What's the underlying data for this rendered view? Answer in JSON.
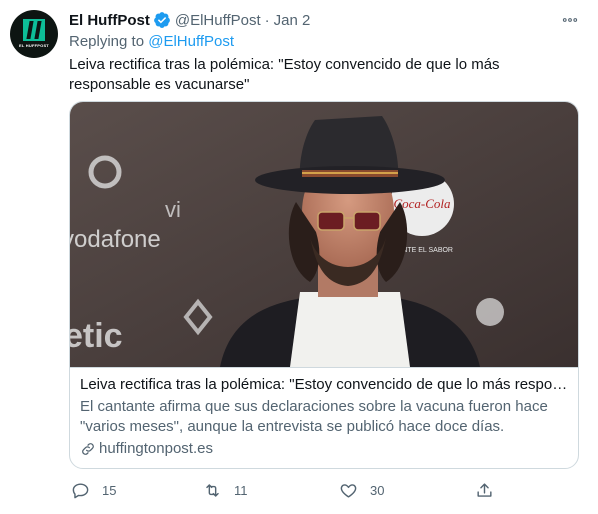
{
  "author": {
    "name": "El HuffPost",
    "handle": "@ElHuffPost",
    "separator": "·",
    "date": "Jan 2",
    "avatar_text": "EL HUFFPOST"
  },
  "replying": {
    "prefix": "Replying to",
    "handle": "@ElHuffPost"
  },
  "tweet": {
    "text": "Leiva rectifica tras la polémica: \"Estoy convencido de que lo más responsable es vacunarse\""
  },
  "card": {
    "title": "Leiva rectifica tras la polémica: \"Estoy convencido de que lo más responsable es vacunarse\"",
    "description": "El cantante afirma que sus declaraciones sobre la vacuna fueron hace \"varios meses\", aunque la entrevista se publicó hace doce días.",
    "domain": "huffingtonpost.es",
    "image_texts": {
      "brand1": "vodafone",
      "brand2": "Coca-Cola",
      "slogan": "SIENTE EL SABOR"
    }
  },
  "actions": {
    "reply_count": "15",
    "retweet_count": "11",
    "like_count": "30"
  },
  "icons": [
    "verified-badge-icon",
    "more-icon",
    "link-icon",
    "reply-icon",
    "retweet-icon",
    "like-icon",
    "share-icon"
  ],
  "colors": {
    "accent": "#1d9bf0",
    "secondary_text": "#536471",
    "border": "#cfd9de",
    "brand_green": "#0dbe98"
  }
}
